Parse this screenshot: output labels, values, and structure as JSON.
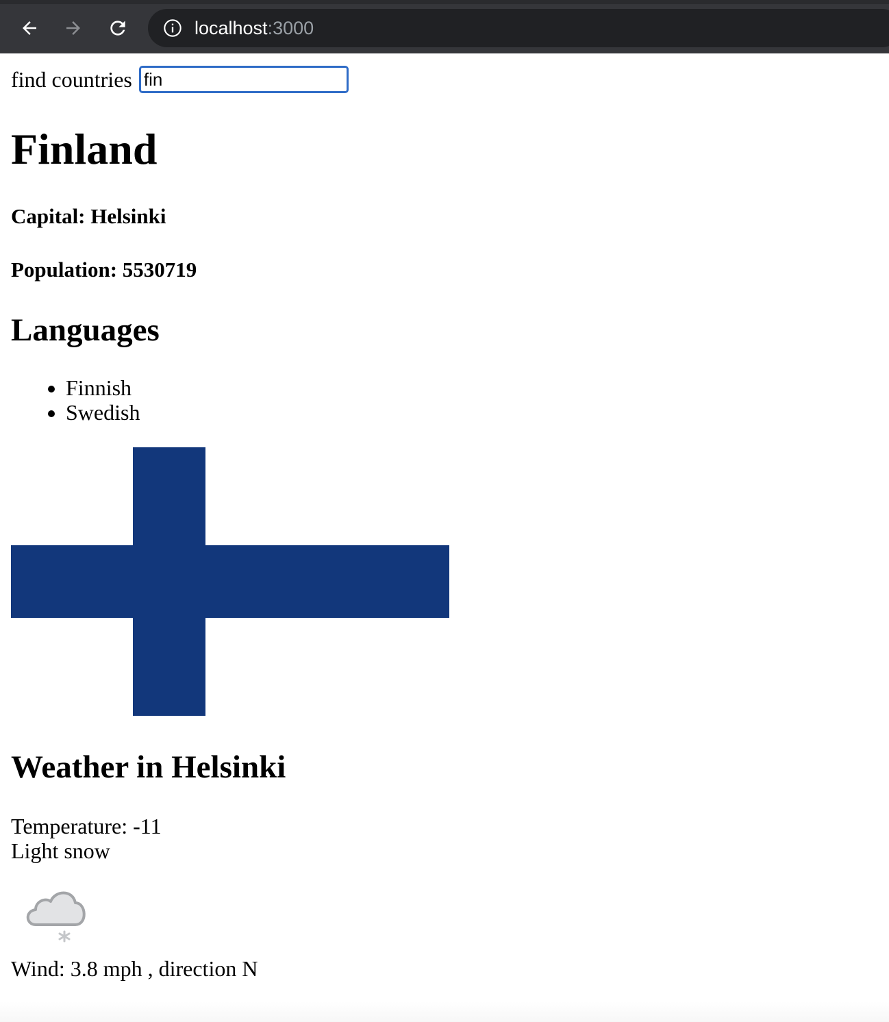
{
  "browser": {
    "url_host": "localhost",
    "url_port": ":3000",
    "chrome_color": "#35363a",
    "omnibox_color": "#202124",
    "icons": {
      "back": "arrow-left-icon",
      "forward": "arrow-right-icon",
      "reload": "reload-icon",
      "site_info": "info-icon"
    }
  },
  "search": {
    "label": "find countries",
    "value": "fin",
    "focus_color": "#2f6cc7"
  },
  "country": {
    "name": "Finland",
    "capital_text": "Capital: Helsinki",
    "population_text": "Population: 5530719",
    "languages_heading": "Languages",
    "languages": [
      "Finnish",
      "Swedish"
    ],
    "flag": {
      "name": "finland-flag",
      "cross_color": "#12377b",
      "field_color": "#ffffff"
    }
  },
  "weather": {
    "heading": "Weather in Helsinki",
    "temperature_text": "Temperature: -11",
    "description": "Light snow",
    "icon": "light-snow-cloud-icon",
    "wind_text": "Wind: 3.8 mph , direction N"
  }
}
